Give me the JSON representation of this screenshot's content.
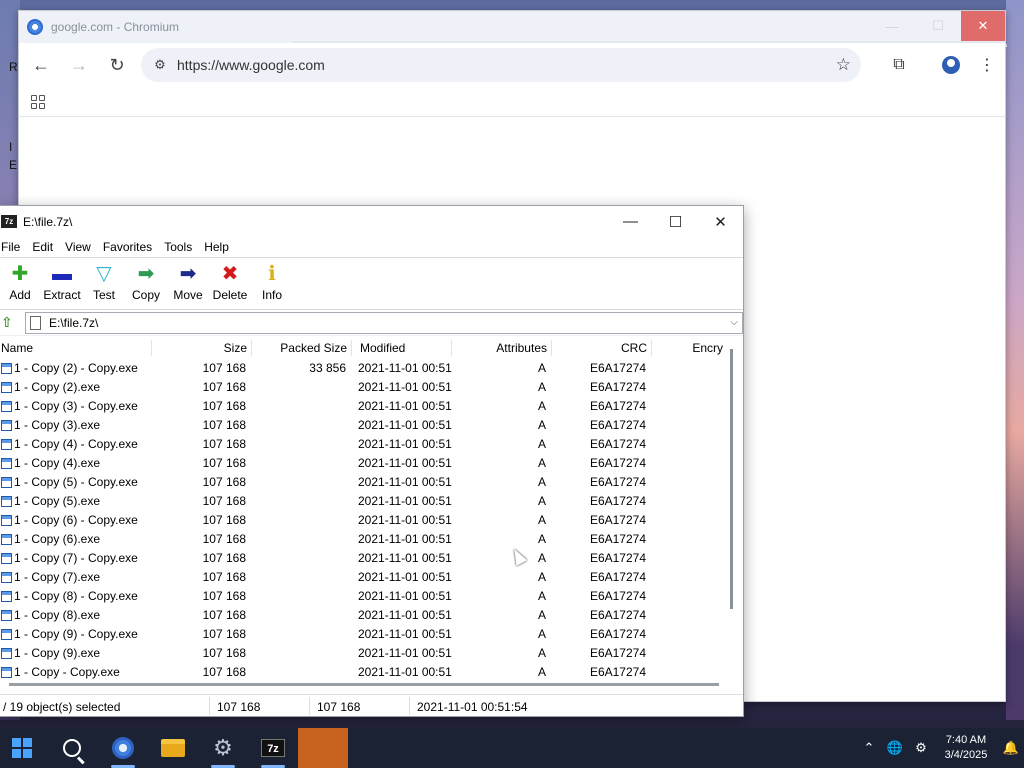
{
  "desktop": {
    "letters": [
      "R",
      "I",
      "E"
    ]
  },
  "chromium": {
    "window_title": "google.com - Chromium",
    "url": "https://www.google.com",
    "buttons": {
      "minimize": "—",
      "maximize": "☐",
      "close": "✕",
      "back": "←",
      "forward": "→",
      "reload": "↻"
    }
  },
  "zip": {
    "window_title": "E:\\file.7z\\",
    "menu": [
      "File",
      "Edit",
      "View",
      "Favorites",
      "Tools",
      "Help"
    ],
    "toolbar": [
      {
        "label": "Add",
        "icon": "plus-icon",
        "color": "#2fa82a"
      },
      {
        "label": "Extract",
        "icon": "minus-icon",
        "color": "#1d2ab8"
      },
      {
        "label": "Test",
        "icon": "check-icon",
        "color": "#29b7c9"
      },
      {
        "label": "Copy",
        "icon": "copy-arrow-icon",
        "color": "#2e9a55"
      },
      {
        "label": "Move",
        "icon": "move-arrow-icon",
        "color": "#1d2a8c"
      },
      {
        "label": "Delete",
        "icon": "delete-x-icon",
        "color": "#d41a1a"
      },
      {
        "label": "Info",
        "icon": "info-icon",
        "color": "#d8b21a"
      }
    ],
    "path": "E:\\file.7z\\",
    "columns": [
      "Name",
      "Size",
      "Packed Size",
      "Modified",
      "Attributes",
      "CRC",
      "Encry"
    ],
    "rows": [
      {
        "name": "1 - Copy (2) - Copy.exe",
        "size": "107 168",
        "packed": "33 856",
        "modified": "2021-11-01 00:51",
        "attr": "A",
        "crc": "E6A17274"
      },
      {
        "name": "1 - Copy (2).exe",
        "size": "107 168",
        "packed": "",
        "modified": "2021-11-01 00:51",
        "attr": "A",
        "crc": "E6A17274"
      },
      {
        "name": "1 - Copy (3) - Copy.exe",
        "size": "107 168",
        "packed": "",
        "modified": "2021-11-01 00:51",
        "attr": "A",
        "crc": "E6A17274"
      },
      {
        "name": "1 - Copy (3).exe",
        "size": "107 168",
        "packed": "",
        "modified": "2021-11-01 00:51",
        "attr": "A",
        "crc": "E6A17274"
      },
      {
        "name": "1 - Copy (4) - Copy.exe",
        "size": "107 168",
        "packed": "",
        "modified": "2021-11-01 00:51",
        "attr": "A",
        "crc": "E6A17274"
      },
      {
        "name": "1 - Copy (4).exe",
        "size": "107 168",
        "packed": "",
        "modified": "2021-11-01 00:51",
        "attr": "A",
        "crc": "E6A17274"
      },
      {
        "name": "1 - Copy (5) - Copy.exe",
        "size": "107 168",
        "packed": "",
        "modified": "2021-11-01 00:51",
        "attr": "A",
        "crc": "E6A17274"
      },
      {
        "name": "1 - Copy (5).exe",
        "size": "107 168",
        "packed": "",
        "modified": "2021-11-01 00:51",
        "attr": "A",
        "crc": "E6A17274"
      },
      {
        "name": "1 - Copy (6) - Copy.exe",
        "size": "107 168",
        "packed": "",
        "modified": "2021-11-01 00:51",
        "attr": "A",
        "crc": "E6A17274"
      },
      {
        "name": "1 - Copy (6).exe",
        "size": "107 168",
        "packed": "",
        "modified": "2021-11-01 00:51",
        "attr": "A",
        "crc": "E6A17274"
      },
      {
        "name": "1 - Copy (7) - Copy.exe",
        "size": "107 168",
        "packed": "",
        "modified": "2021-11-01 00:51",
        "attr": "A",
        "crc": "E6A17274"
      },
      {
        "name": "1 - Copy (7).exe",
        "size": "107 168",
        "packed": "",
        "modified": "2021-11-01 00:51",
        "attr": "A",
        "crc": "E6A17274"
      },
      {
        "name": "1 - Copy (8) - Copy.exe",
        "size": "107 168",
        "packed": "",
        "modified": "2021-11-01 00:51",
        "attr": "A",
        "crc": "E6A17274"
      },
      {
        "name": "1 - Copy (8).exe",
        "size": "107 168",
        "packed": "",
        "modified": "2021-11-01 00:51",
        "attr": "A",
        "crc": "E6A17274"
      },
      {
        "name": "1 - Copy (9) - Copy.exe",
        "size": "107 168",
        "packed": "",
        "modified": "2021-11-01 00:51",
        "attr": "A",
        "crc": "E6A17274"
      },
      {
        "name": "1 - Copy (9).exe",
        "size": "107 168",
        "packed": "",
        "modified": "2021-11-01 00:51",
        "attr": "A",
        "crc": "E6A17274"
      },
      {
        "name": "1 - Copy - Copy.exe",
        "size": "107 168",
        "packed": "",
        "modified": "2021-11-01 00:51",
        "attr": "A",
        "crc": "E6A17274"
      }
    ],
    "status": {
      "selected": "/ 19 object(s) selected",
      "size": "107 168",
      "packed": "107 168",
      "modified": "2021-11-01 00:51:54"
    }
  },
  "taskbar": {
    "time": "7:40 AM",
    "date": "3/4/2025",
    "apps": [
      "windows-start-icon",
      "search-icon",
      "chromium-icon",
      "file-explorer-icon",
      "settings-gear-icon",
      "7zip-icon"
    ]
  }
}
